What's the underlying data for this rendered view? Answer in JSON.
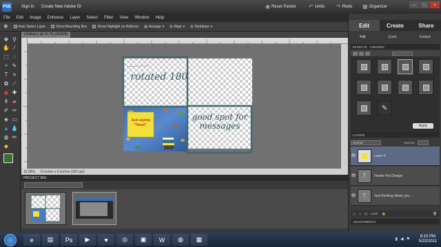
{
  "titlebar": {
    "logo": "PSE",
    "sign_in": "Sign In",
    "create_id": "Create New Adobe ID",
    "reset_panels": "Reset Panels",
    "undo": "Undo",
    "redo": "Redo",
    "organizer": "Organizer"
  },
  "menu": [
    "File",
    "Edit",
    "Image",
    "Enhance",
    "Layer",
    "Select",
    "Filter",
    "View",
    "Window",
    "Help"
  ],
  "options": {
    "auto_select": "Auto Select Layer",
    "bounding_box": "Show Bounding Box",
    "highlight": "Show Highlight on Rollover",
    "arrange": "Arrange",
    "align": "Align",
    "distribute": "Distribute"
  },
  "document": {
    "tab_title": "Untitled-1 @ 16.7% (RGB/8)",
    "zoom": "16.68%",
    "doc_size": "8 inches x 6 inches (300 ppi)",
    "text_rotated": "rotated 180",
    "text_good_spot": "good spot for messages",
    "sticky_note": "Just saying \"Tweet\"."
  },
  "project_bin": {
    "header": "PROJECT BIN",
    "select_value": ""
  },
  "panel": {
    "mode_tabs": [
      "Edit",
      "Create",
      "Share"
    ],
    "active_mode": "Edit",
    "sub_tabs": [
      "Full",
      "Quick",
      "Guided"
    ],
    "active_sub": "Full",
    "effects_label": "EFFECTS",
    "content_label": "CONTENT",
    "apply": "Apply",
    "layers_label": "LAYERS",
    "blend_mode": "Normal",
    "opacity_label": "Opacity:",
    "lock_label": "Lock:",
    "adjustments_label": "ADJUSTMENTS",
    "layers": [
      {
        "name": "Layer 5",
        "active": true
      },
      {
        "name": "Flower Pot Design",
        "active": false
      },
      {
        "name": "Just thinking about you...",
        "active": false
      }
    ]
  },
  "taskbar": {
    "time": "8:10 PM",
    "date": "5/22/2011"
  },
  "colors": {
    "accent_frame": "#3f6b70",
    "canvas_bg": "#717171",
    "layer_active": "#5c6a86",
    "sticky": "#f2e13b"
  }
}
